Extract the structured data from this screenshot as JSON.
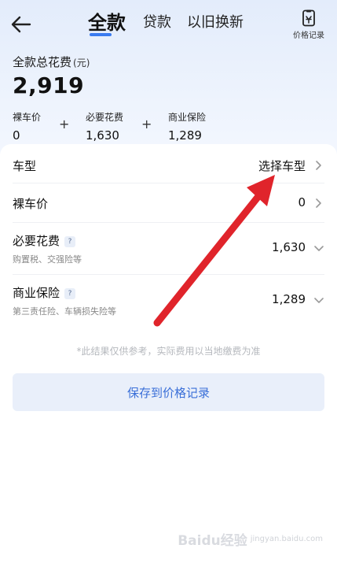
{
  "header": {
    "tabs": [
      {
        "label": "全款",
        "active": true
      },
      {
        "label": "贷款",
        "active": false
      },
      {
        "label": "以旧换新",
        "active": false
      }
    ],
    "record_label": "价格记录",
    "icons": {
      "back": "arrow-left-icon",
      "record": "phone-clipboard-icon"
    }
  },
  "summary": {
    "title": "全款总花费",
    "unit": "(元)",
    "total": "2,919",
    "items": [
      {
        "label": "裸车价",
        "value": "0"
      },
      {
        "label": "必要花费",
        "value": "1,630"
      },
      {
        "label": "商业保险",
        "value": "1,289"
      }
    ],
    "operator": "+"
  },
  "rows": [
    {
      "title": "车型",
      "value": "选择车型",
      "subtitle": "",
      "help": false,
      "chevron": "chevron-right-icon"
    },
    {
      "title": "裸车价",
      "value": "0",
      "subtitle": "",
      "help": false,
      "chevron": "chevron-right-icon"
    },
    {
      "title": "必要花费",
      "value": "1,630",
      "subtitle": "购置税、交强险等",
      "help": true,
      "chevron": "chevron-down-icon"
    },
    {
      "title": "商业保险",
      "value": "1,289",
      "subtitle": "第三责任险、车辆损失险等",
      "help": true,
      "chevron": "chevron-down-icon"
    }
  ],
  "help_glyph": "?",
  "disclaimer": "*此结果仅供参考，实际费用以当地缴费为准",
  "save_button": "保存到价格记录",
  "watermark": {
    "brand": "Baidu经验",
    "sub": "jingyan.baidu.com"
  },
  "colors": {
    "accent": "#3a7bf0",
    "annotation_arrow": "#e0242b",
    "button_bg": "#e9effa",
    "button_text": "#3a6fd8"
  }
}
